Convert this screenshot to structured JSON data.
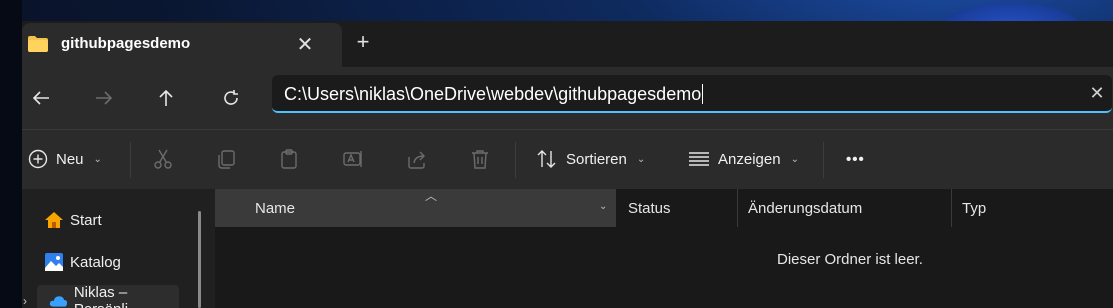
{
  "tab": {
    "title": "githubpagesdemo",
    "close": "✕",
    "add": "+"
  },
  "nav": {
    "back": "←",
    "forward": "→",
    "up": "↑",
    "refresh": "↻"
  },
  "address": {
    "path": "C:\\Users\\niklas\\OneDrive\\webdev\\githubpagesdemo",
    "clear": "✕"
  },
  "commands": {
    "new_label": "Neu",
    "sort_label": "Sortieren",
    "view_label": "Anzeigen",
    "more_label": "•••"
  },
  "sidebar": {
    "items": [
      {
        "label": "Start",
        "icon": "home-icon"
      },
      {
        "label": "Katalog",
        "icon": "gallery-icon"
      },
      {
        "label": "Niklas – Persönli",
        "icon": "onedrive-icon"
      }
    ]
  },
  "columns": {
    "name": "Name",
    "status": "Status",
    "date": "Änderungsdatum",
    "type": "Typ"
  },
  "empty_message": "Dieser Ordner ist leer.",
  "colors": {
    "accent": "#4cc2ff",
    "folder": "#f2c14e",
    "home": "#f7a600"
  }
}
